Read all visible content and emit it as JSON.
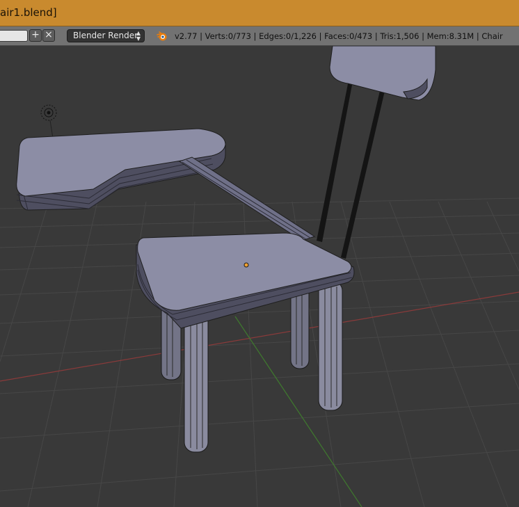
{
  "window": {
    "title": "air1.blend]"
  },
  "header": {
    "add_label": "+",
    "close_label": "×",
    "render_engine": "Blender Render",
    "stats": "v2.77 | Verts:0/773 | Edges:0/1,226 | Faces:0/473 | Tris:1,506 | Mem:8.31M | Chair"
  },
  "icons": {
    "add": "plus-icon",
    "close": "x-icon",
    "dropdown": "updown-arrows-icon",
    "blender": "blender-logo-icon",
    "lamp": "lamp-icon",
    "origin": "object-origin-icon"
  },
  "colors": {
    "titlebar": "#c98a2e",
    "header": "#727272",
    "viewport_bg": "#393939",
    "grid": "#4a4a4a",
    "x_axis": "#8a3a3a",
    "y_axis": "#3f7a2e",
    "mesh_face": "#8c8da5",
    "mesh_face_light": "#9a9bb2",
    "origin_dot": "#f0a030"
  }
}
